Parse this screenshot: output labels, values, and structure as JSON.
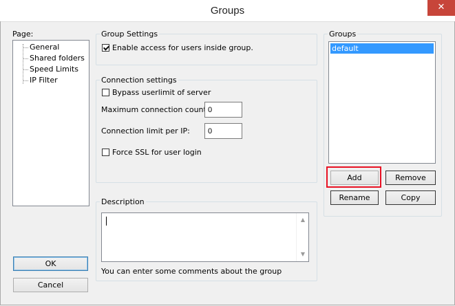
{
  "window": {
    "title": "Groups",
    "close_glyph": "✕"
  },
  "page_tree": {
    "label": "Page:",
    "items": [
      {
        "label": "General",
        "selected": true
      },
      {
        "label": "Shared folders"
      },
      {
        "label": "Speed Limits"
      },
      {
        "label": "IP Filter"
      }
    ]
  },
  "group_settings": {
    "legend": "Group Settings",
    "enable_access": {
      "label": "Enable access for users inside group.",
      "checked": true
    }
  },
  "connection_settings": {
    "legend": "Connection settings",
    "bypass": {
      "label": "Bypass userlimit of server",
      "checked": false
    },
    "max_connection": {
      "label": "Maximum connection count:",
      "value": "0"
    },
    "limit_per_ip": {
      "label": "Connection limit per IP:",
      "value": "0"
    },
    "force_ssl": {
      "label": "Force SSL for user login",
      "checked": false
    }
  },
  "description": {
    "legend": "Description",
    "value": "",
    "hint": "You can enter some comments about the group"
  },
  "groups": {
    "legend": "Groups",
    "items": [
      {
        "label": "default",
        "selected": true
      }
    ],
    "add_label": "Add",
    "remove_label": "Remove",
    "rename_label": "Rename",
    "copy_label": "Copy",
    "highlight_color": "#e81123"
  },
  "footer": {
    "ok_label": "OK",
    "cancel_label": "Cancel"
  },
  "colors": {
    "selection": "#3399ff",
    "close_button": "#c7453a"
  }
}
